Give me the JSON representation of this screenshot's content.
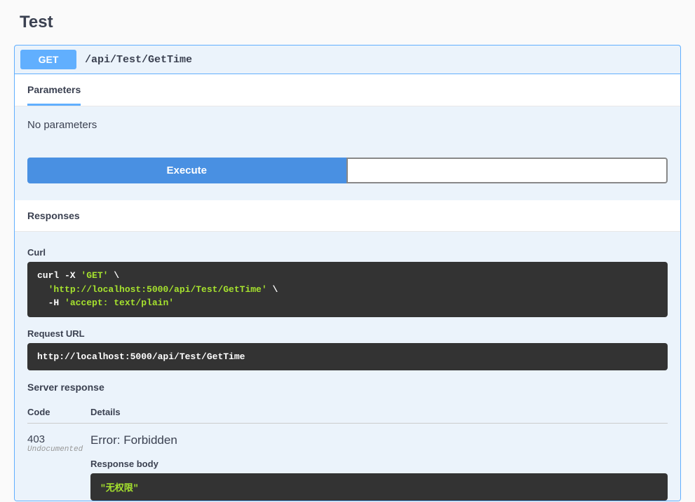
{
  "page": {
    "title": "Test"
  },
  "operation": {
    "method": "GET",
    "path": "/api/Test/GetTime"
  },
  "parameters": {
    "tab_label": "Parameters",
    "empty_text": "No parameters"
  },
  "actions": {
    "execute": "Execute",
    "clear": ""
  },
  "responses": {
    "heading": "Responses",
    "curl_label": "Curl",
    "curl_line1_prefix": "curl -X ",
    "curl_method": "'GET'",
    "curl_line1_suffix": " \\",
    "curl_line2_prefix": "  ",
    "curl_url": "'http://localhost:5000/api/Test/GetTime'",
    "curl_line2_suffix": " \\",
    "curl_line3_prefix": "  -H ",
    "curl_header": "'accept: text/plain'",
    "request_url_label": "Request URL",
    "request_url": "http://localhost:5000/api/Test/GetTime",
    "server_response_label": "Server response",
    "col_code": "Code",
    "col_details": "Details",
    "status_code": "403",
    "undocumented_label": "Undocumented",
    "error_text": "Error: Forbidden",
    "response_body_label": "Response body",
    "response_body_value": "\"无权限\""
  }
}
